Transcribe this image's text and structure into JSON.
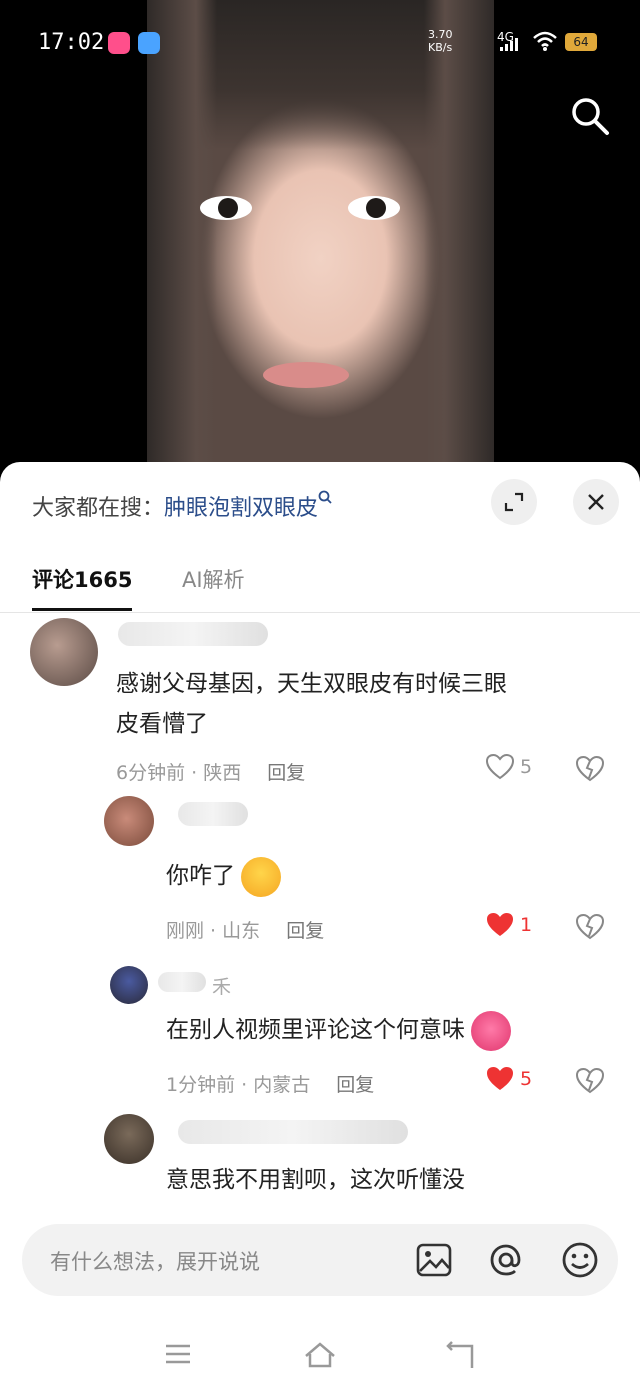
{
  "status_bar": {
    "time": "17:02",
    "net_speed_value": "3.70",
    "net_speed_unit": "KB/s",
    "network": "4G",
    "battery": "64"
  },
  "search_hint": {
    "prefix": "大家都在搜：",
    "query": "肿眼泡割双眼皮"
  },
  "tabs": [
    {
      "label": "评论1665",
      "active": true
    },
    {
      "label": "AI解析",
      "active": false
    }
  ],
  "comments": [
    {
      "text_line1": "感谢父母基因，天生双眼皮有时候三眼",
      "text_line2": "皮看懵了",
      "time": "6分钟前",
      "location": "陕西",
      "reply_label": "回复",
      "likes": "5",
      "liked": false
    },
    {
      "text": "你咋了",
      "time": "刚刚",
      "location": "山东",
      "reply_label": "回复",
      "likes": "1",
      "liked": true
    },
    {
      "name_partial": "禾",
      "text": "在别人视频里评论这个何意味",
      "time": "1分钟前",
      "location": "内蒙古",
      "reply_label": "回复",
      "likes": "5",
      "liked": true
    },
    {
      "text": "意思我不用割呗，这次听懂没"
    }
  ],
  "input_bar": {
    "placeholder": "有什么想法，展开说说"
  },
  "colors": {
    "accent_link": "#2b4d8a",
    "like_red": "#e33",
    "battery": "#e0a83a"
  }
}
